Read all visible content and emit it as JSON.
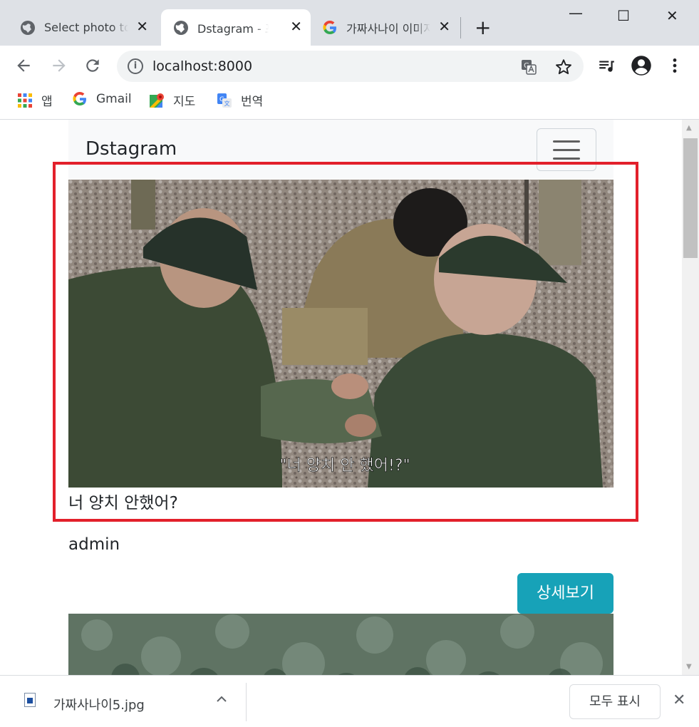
{
  "tabs": [
    {
      "title": "Select photo to upload",
      "icon": "globe-icon",
      "active": false
    },
    {
      "title": "Dstagram - 포스트",
      "icon": "globe-icon",
      "active": true
    },
    {
      "title": "가짜사나이 이미지",
      "icon": "google-icon",
      "active": false
    }
  ],
  "new_tab": "+",
  "window_controls": {
    "minimize": "—",
    "maximize": "☐",
    "close": "✕"
  },
  "address_bar": {
    "url": "localhost:8000",
    "info_icon": "i"
  },
  "toolbar_icons": [
    "back-icon",
    "forward-icon",
    "reload-icon",
    "translate-icon",
    "star-icon",
    "media-icon",
    "profile-icon",
    "menu-icon"
  ],
  "bookmarks": [
    {
      "label": "앱",
      "icon": "apps-grid-icon"
    },
    {
      "label": "Gmail",
      "icon": "google-icon"
    },
    {
      "label": "지도",
      "icon": "maps-icon"
    },
    {
      "label": "번역",
      "icon": "translate-icon"
    }
  ],
  "page": {
    "brand": "Dstagram",
    "posts": [
      {
        "image_text": "\"너 양치 안 했어!?\"",
        "caption": "너 양치 안했어?",
        "author": "admin",
        "detail_button": "상세보기"
      }
    ]
  },
  "downloads": {
    "file_name": "가짜사나이5.jpg",
    "show_all": "모두 표시",
    "close": "✕"
  },
  "colors": {
    "highlight": "#e2202b",
    "detail_button": "#17a2b8",
    "tabstrip": "#dee1e6"
  }
}
